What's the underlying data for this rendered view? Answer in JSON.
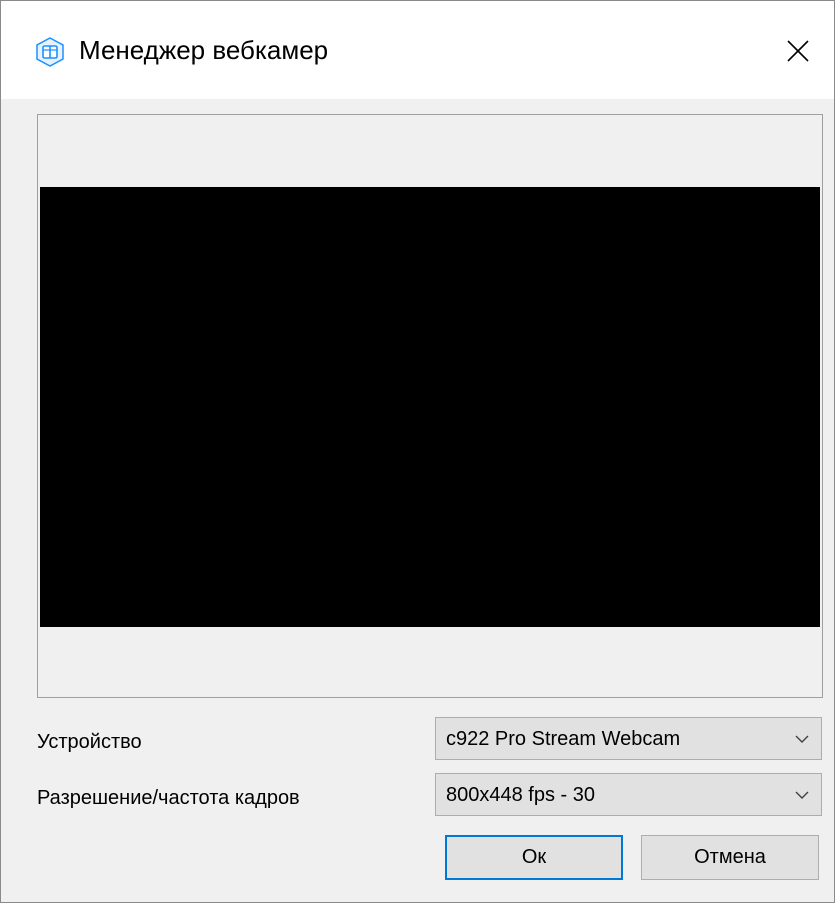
{
  "window": {
    "title": "Менеджер вебкамер",
    "app_icon": "webcam-manager-icon",
    "close_icon": "close-icon"
  },
  "preview": {
    "background_color": "#000000"
  },
  "form": {
    "device_label": "Устройство",
    "device_value": "c922 Pro Stream Webcam",
    "resolution_label": "Разрешение/частота кадров",
    "resolution_value": "800x448 fps - 30"
  },
  "buttons": {
    "ok_label": "Ок",
    "cancel_label": "Отмена"
  },
  "colors": {
    "accent": "#0078d7",
    "icon_blue": "#1e90ff"
  }
}
